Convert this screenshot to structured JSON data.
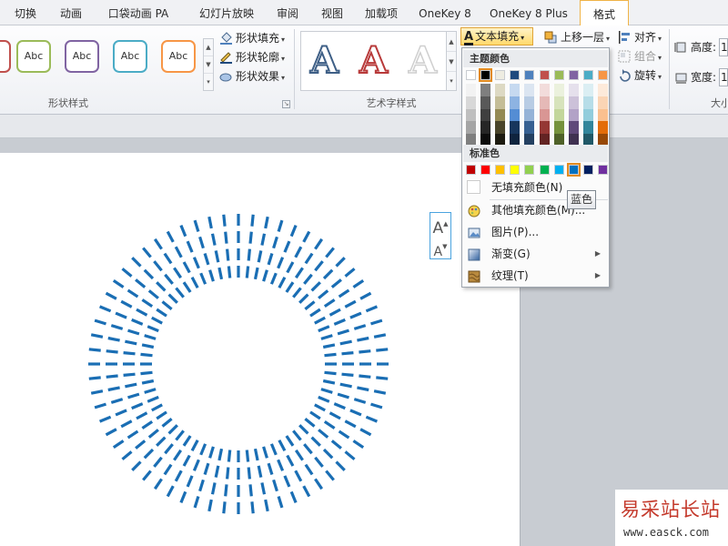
{
  "tabs": [
    {
      "label": "切换"
    },
    {
      "label": "动画"
    },
    {
      "label": "口袋动画 PA"
    },
    {
      "label": "幻灯片放映"
    },
    {
      "label": "审阅"
    },
    {
      "label": "视图"
    },
    {
      "label": "加载项"
    },
    {
      "label": "OneKey 8"
    },
    {
      "label": "OneKey 8 Plus"
    },
    {
      "label": "格式"
    }
  ],
  "shape_styles": {
    "presets": [
      {
        "label": "Abc",
        "border": "#9bbb59"
      },
      {
        "label": "Abc",
        "border": "#8064a2"
      },
      {
        "label": "Abc",
        "border": "#4bacc6"
      },
      {
        "label": "Abc",
        "border": "#f79646"
      }
    ],
    "fill_label": "形状填充",
    "outline_label": "形状轮廓",
    "effects_label": "形状效果",
    "group_label": "形状样式"
  },
  "wordart": {
    "group_label": "艺术字样式",
    "letter": "A",
    "text_fill_label": "文本填充"
  },
  "arrange": {
    "bring_forward_label": "上移一层",
    "align_label": "对齐",
    "group_label": "组合",
    "rotate_label": "旋转"
  },
  "size": {
    "height_label": "高度:",
    "height_value": "1",
    "width_label": "宽度:",
    "width_value": "1",
    "group_label": "大小"
  },
  "fill_menu": {
    "theme_colors_label": "主题颜色",
    "theme_colors": [
      "#ffffff",
      "#000000",
      "#eeece1",
      "#1f497d",
      "#4f81bd",
      "#c0504d",
      "#9bbb59",
      "#8064a2",
      "#4bacc6",
      "#f79646"
    ],
    "theme_shades": [
      [
        "#f2f2f2",
        "#d8d8d8",
        "#bfbfbf",
        "#a5a5a5",
        "#7f7f7f"
      ],
      [
        "#7f7f7f",
        "#595959",
        "#3f3f3f",
        "#262626",
        "#0c0c0c"
      ],
      [
        "#ddd9c3",
        "#c4bd97",
        "#938953",
        "#494429",
        "#1d1b10"
      ],
      [
        "#c6d9f0",
        "#8db3e2",
        "#548dd4",
        "#17365d",
        "#0f243e"
      ],
      [
        "#dbe5f1",
        "#b8cce4",
        "#95b3d7",
        "#366092",
        "#244061"
      ],
      [
        "#f2dcdb",
        "#e5b9b7",
        "#d99694",
        "#953734",
        "#632423"
      ],
      [
        "#ebf1dd",
        "#d7e3bc",
        "#c3d69b",
        "#76923c",
        "#4f6128"
      ],
      [
        "#e5e0ec",
        "#ccc1d9",
        "#b2a2c7",
        "#5f497a",
        "#3f3151"
      ],
      [
        "#dbeef3",
        "#b7dde8",
        "#92cddc",
        "#31859b",
        "#205867"
      ],
      [
        "#fdeada",
        "#fbd5b5",
        "#fac08f",
        "#e36c09",
        "#974806"
      ]
    ],
    "standard_colors_label": "标准色",
    "standard_colors": [
      "#c00000",
      "#ff0000",
      "#ffc000",
      "#ffff00",
      "#92d050",
      "#00b050",
      "#00b0f0",
      "#0070c0",
      "#002060",
      "#7030a0"
    ],
    "selected_theme_index": 1,
    "selected_standard_index": 7,
    "no_fill_label": "无填充颜色(N)",
    "more_colors_label": "其他填充颜色(M)...",
    "picture_label": "图片(P)...",
    "gradient_label": "渐变(G)",
    "texture_label": "纹理(T)",
    "tooltip": "蓝色"
  },
  "mini_toolbar": {
    "grow_label": "A",
    "shrink_label": "A"
  },
  "slide": {
    "ray_color": "#1a6eb4"
  },
  "watermark": {
    "title": "易采站长站",
    "url": "www.easck.com"
  }
}
